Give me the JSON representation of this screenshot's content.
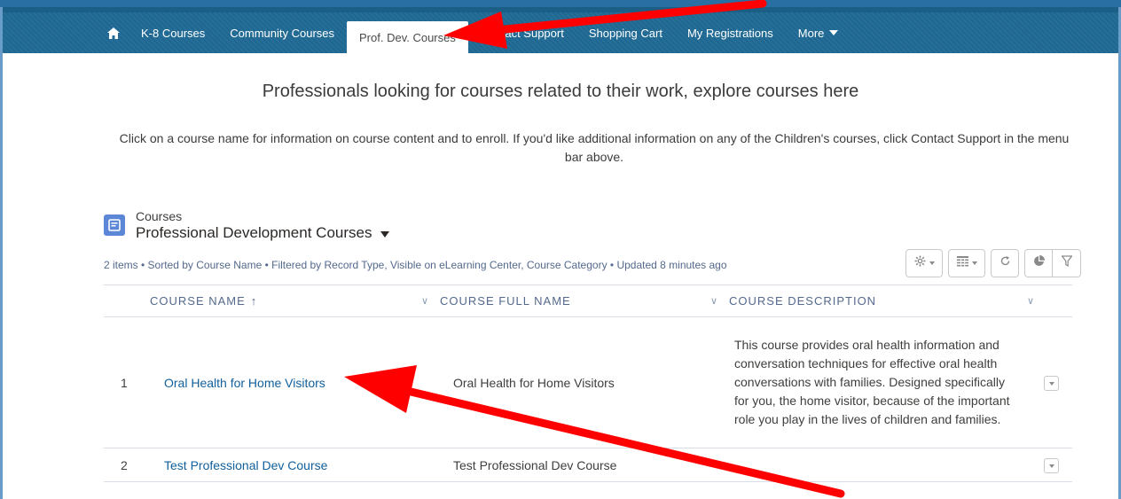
{
  "nav": {
    "items": [
      {
        "label": "K-8 Courses"
      },
      {
        "label": "Community Courses"
      },
      {
        "label": "Prof. Dev. Courses"
      },
      {
        "label": "Contact Support"
      },
      {
        "label": "Shopping Cart"
      },
      {
        "label": "My Registrations"
      },
      {
        "label": "More"
      }
    ],
    "home_icon": "home-icon",
    "active_index": 2
  },
  "headline": "Professionals looking for courses related to their work, explore courses here",
  "instructions": "Click on a course name for information on course content and to enroll. If you'd like additional information on any of the Children's courses, click Contact Support in the menu bar above.",
  "list": {
    "object_label": "Courses",
    "view_name": "Professional Development Courses",
    "meta": "2 items • Sorted by Course Name • Filtered by Record Type, Visible on eLearning Center, Course Category • Updated 8 minutes ago",
    "toolbar_icons": [
      "gear-icon",
      "table-icon",
      "refresh-icon",
      "chart-icon",
      "filter-icon"
    ],
    "columns": [
      {
        "label": "COURSE NAME",
        "sorted": "asc"
      },
      {
        "label": "COURSE FULL NAME"
      },
      {
        "label": "COURSE DESCRIPTION"
      }
    ],
    "rows": [
      {
        "num": "1",
        "name": "Oral Health for Home Visitors",
        "full_name": "Oral Health for Home Visitors",
        "description": "This course provides oral health information and conversation techniques for effective oral health conversations with families. Designed specifically for you, the home visitor, because of the important role you play in the lives of children and families."
      },
      {
        "num": "2",
        "name": "Test Professional Dev Course",
        "full_name": "Test Professional Dev Course",
        "description": ""
      }
    ]
  },
  "colors": {
    "nav_bg": "#1f6a95",
    "link": "#11609c",
    "annotation_arrow": "#ff0000"
  }
}
